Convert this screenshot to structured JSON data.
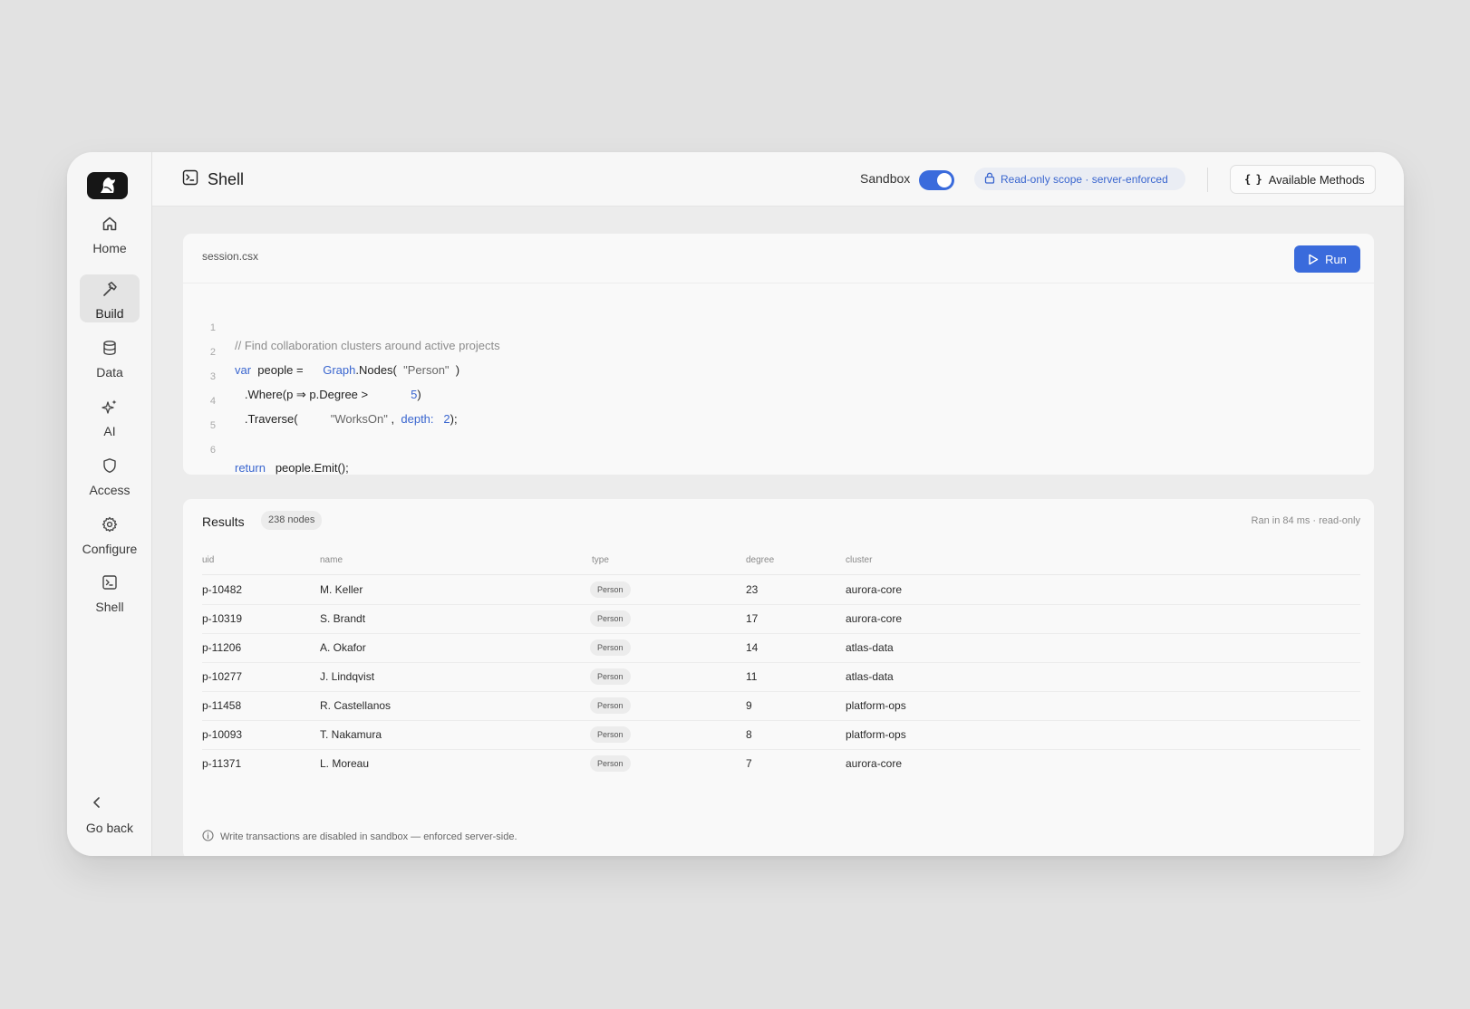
{
  "sidebar": {
    "items": [
      {
        "label": "Home",
        "icon": "home-icon",
        "active": false
      },
      {
        "label": "Build",
        "icon": "hammer-icon",
        "active": true
      },
      {
        "label": "Data",
        "icon": "database-icon",
        "active": false
      },
      {
        "label": "AI",
        "icon": "sparkles-icon",
        "active": false
      },
      {
        "label": "Access",
        "icon": "shield-icon",
        "active": false
      },
      {
        "label": "Configure",
        "icon": "gear-icon",
        "active": false
      },
      {
        "label": "Shell",
        "icon": "terminal-icon",
        "active": false
      }
    ],
    "go_back": "Go back"
  },
  "header": {
    "title": "Shell",
    "sandbox_label": "Sandbox",
    "sandbox_enabled": true,
    "scope_text": "Read-only scope · server-enforced",
    "methods_label": "Available Methods",
    "methods_glyph": "{ }"
  },
  "editor": {
    "filename": "session.csx",
    "run_label": "Run",
    "line_numbers": [
      "1",
      "2",
      "3",
      "4",
      "5",
      "6"
    ],
    "tokens": {
      "l1_comment": "// Find collaboration clusters around active projects",
      "l2_var": "var",
      "l2_people": "people =",
      "l2_graph": "Graph",
      "l2_nodes": ".Nodes(",
      "l2_str": "\"Person\"",
      "l2_close": ")",
      "l3_where": ".Where(p ⇒ p.Degree >",
      "l3_num": "5",
      "l3_close": ")",
      "l4_trav": ".Traverse(",
      "l4_str": "\"WorksOn\"",
      "l4_comma": ",",
      "l4_depth": "depth:",
      "l4_num": "2",
      "l4_close": ");",
      "l6_return": "return",
      "l6_emit": "people.Emit();"
    }
  },
  "results": {
    "title": "Results",
    "count": "238 nodes",
    "meta": "Ran in 84 ms · read-only",
    "columns": {
      "uid": "uid",
      "name": "name",
      "type": "type",
      "degree": "degree",
      "cluster": "cluster"
    },
    "rows": [
      {
        "uid": "p-10482",
        "name": "M. Keller",
        "type": "Person",
        "degree": "23",
        "cluster": "aurora-core"
      },
      {
        "uid": "p-10319",
        "name": "S. Brandt",
        "type": "Person",
        "degree": "17",
        "cluster": "aurora-core"
      },
      {
        "uid": "p-11206",
        "name": "A. Okafor",
        "type": "Person",
        "degree": "14",
        "cluster": "atlas-data"
      },
      {
        "uid": "p-10277",
        "name": "J. Lindqvist",
        "type": "Person",
        "degree": "11",
        "cluster": "atlas-data"
      },
      {
        "uid": "p-11458",
        "name": "R. Castellanos",
        "type": "Person",
        "degree": "9",
        "cluster": "platform-ops"
      },
      {
        "uid": "p-10093",
        "name": "T. Nakamura",
        "type": "Person",
        "degree": "8",
        "cluster": "platform-ops"
      },
      {
        "uid": "p-11371",
        "name": "L. Moreau",
        "type": "Person",
        "degree": "7",
        "cluster": "aurora-core"
      }
    ],
    "footnote": "Write transactions are disabled in sandbox — enforced server-side."
  },
  "colors": {
    "accent": "#3a6bdc",
    "background": "#e2e2e2",
    "sidebar": "#f6f6f6",
    "card": "#f9f9f9"
  }
}
